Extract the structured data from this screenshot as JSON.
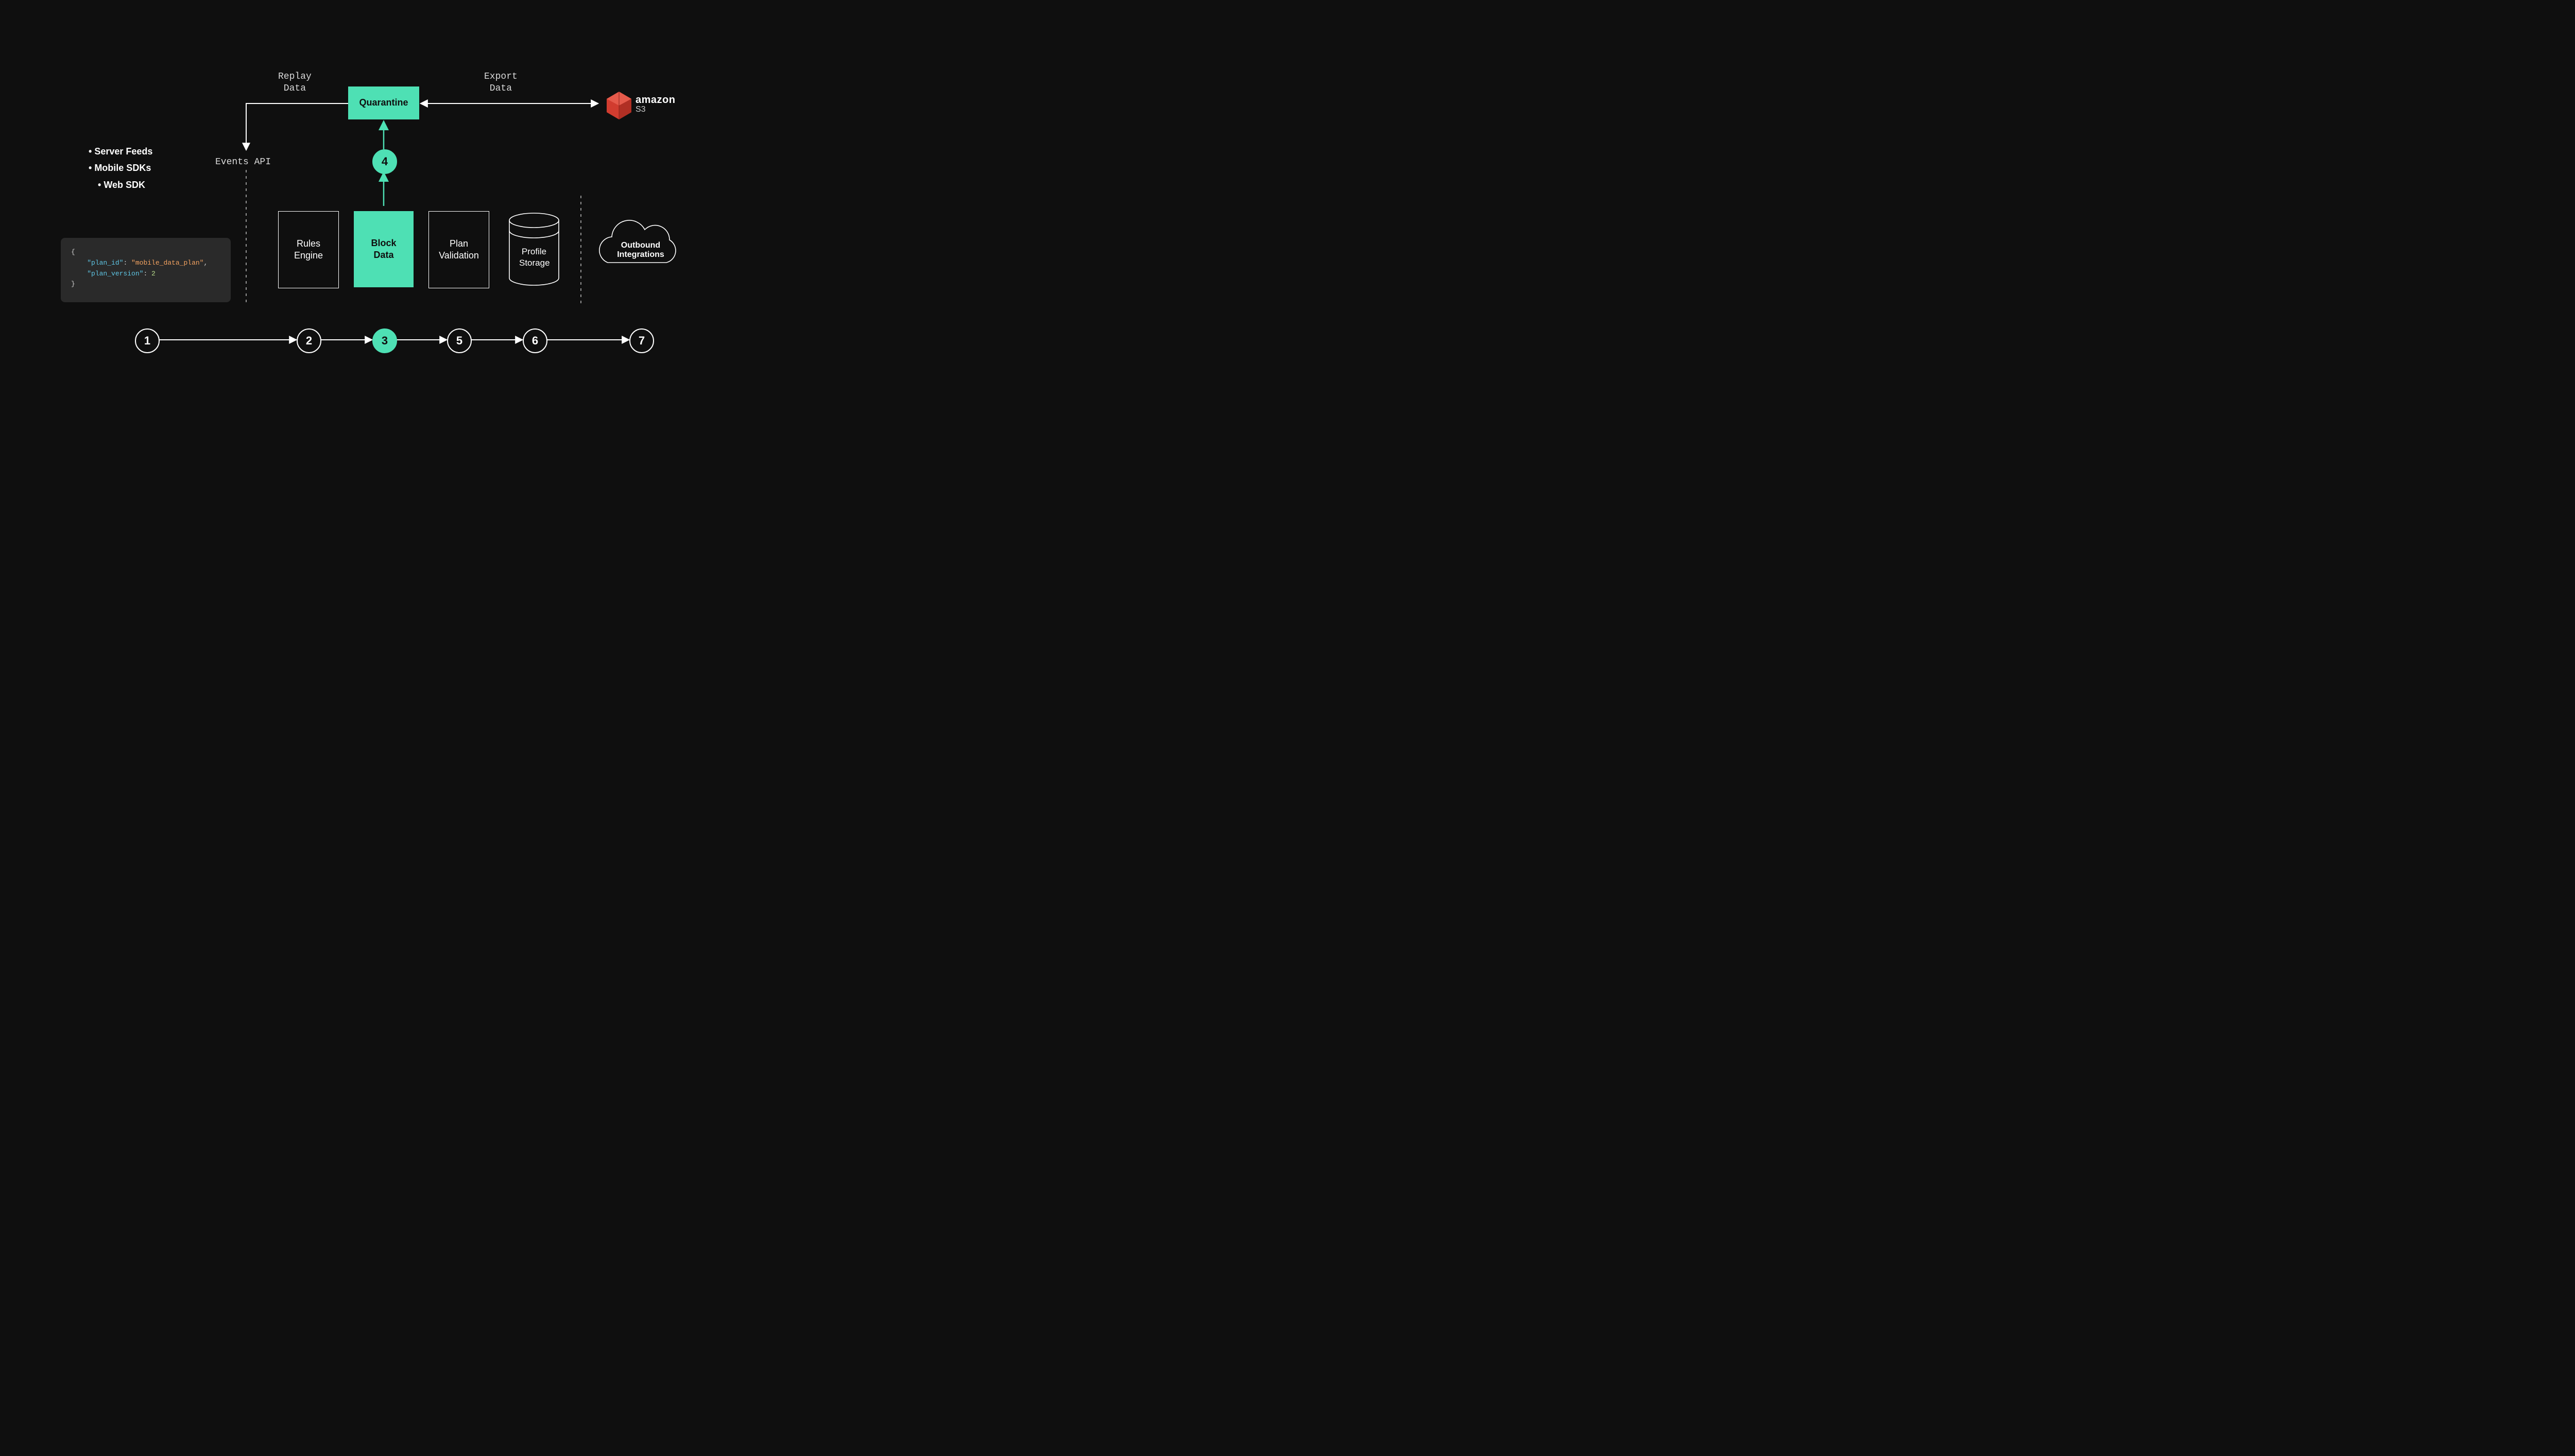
{
  "top": {
    "replay_label": "Replay\nData",
    "export_label": "Export\nData",
    "quarantine_label": "Quarantine",
    "s3_brand": "amazon",
    "s3_service": "S3"
  },
  "sources": {
    "bullets": [
      "Server Feeds",
      "Mobile SDKs",
      "Web SDK"
    ],
    "events_api_label": "Events API"
  },
  "code": {
    "open": "{",
    "key1": "\"plan_id\"",
    "val1": "\"mobile_data_plan\"",
    "key2": "\"plan_version\"",
    "val2": "2",
    "close": "}"
  },
  "pipeline": {
    "rules_engine": "Rules\nEngine",
    "block_data": "Block\nData",
    "plan_validation": "Plan\nValidation",
    "profile_storage": "Profile\nStorage",
    "outbound": "Outbound\nIntegrations"
  },
  "steps": {
    "s1": "1",
    "s2": "2",
    "s3": "3",
    "s4": "4",
    "s5": "5",
    "s6": "6",
    "s7": "7"
  },
  "colors": {
    "accent": "#4ee0b4",
    "bg": "#0f0f0f",
    "s3_red": "#d13c2f"
  }
}
